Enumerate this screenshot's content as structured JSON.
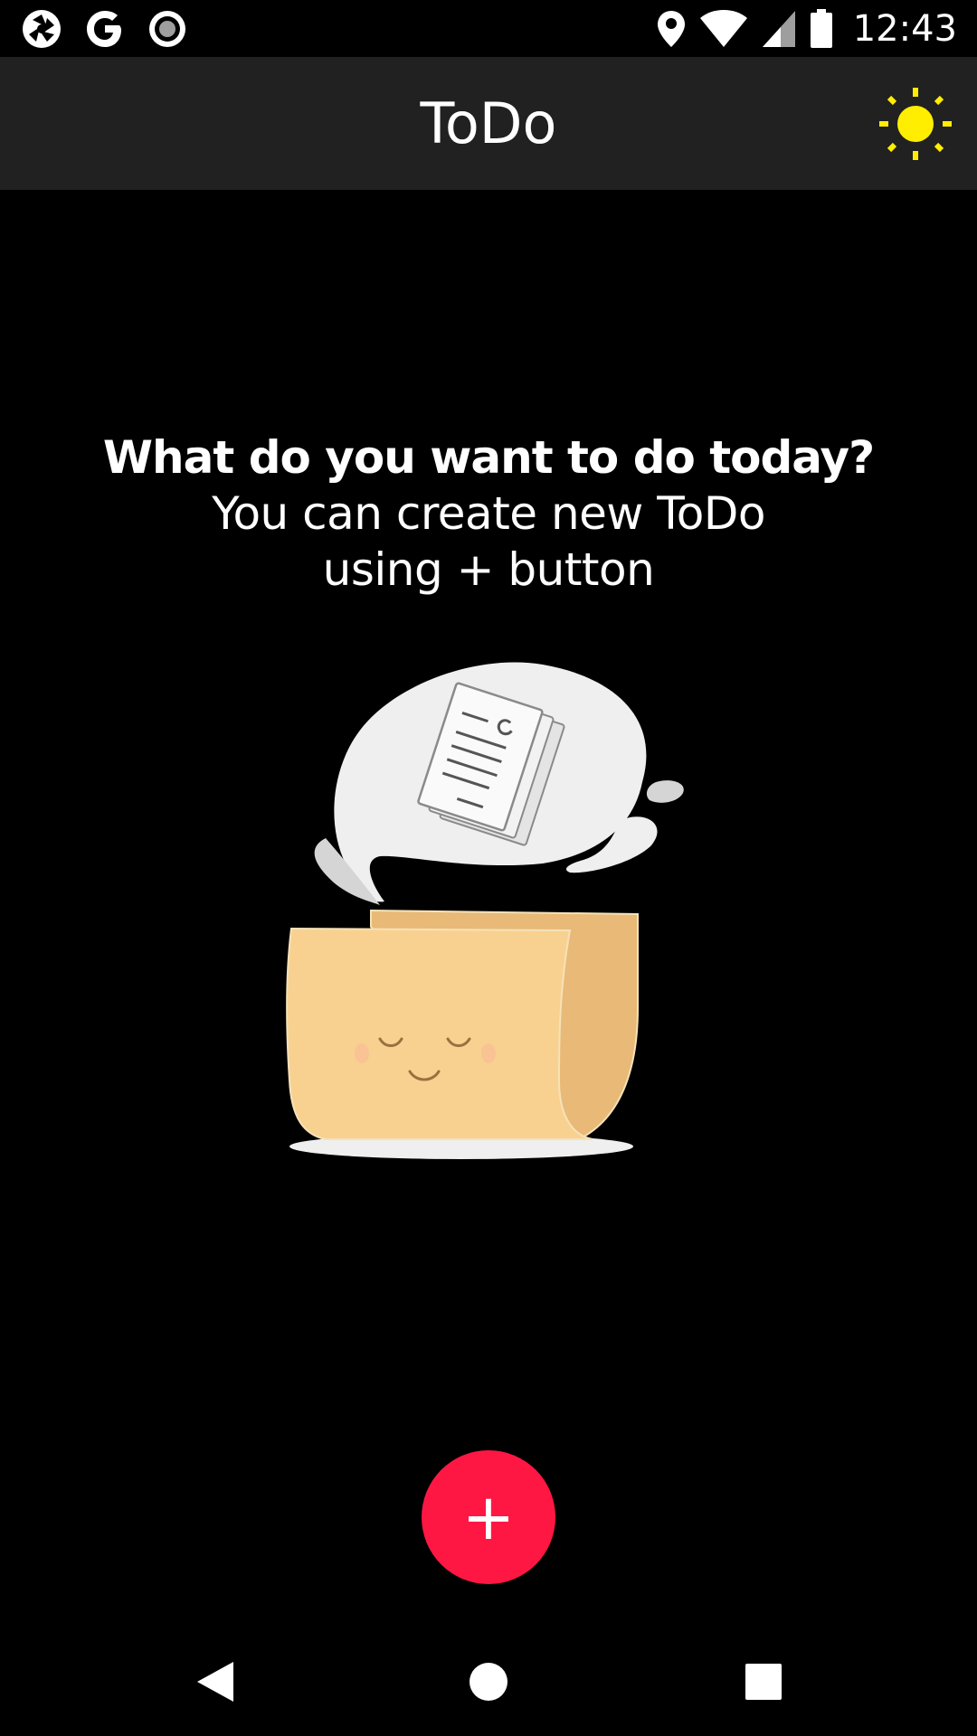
{
  "status_bar": {
    "time": "12:43",
    "left_icons": [
      "aperture-icon",
      "google-icon",
      "record-icon"
    ],
    "right_icons": [
      "location-icon",
      "wifi-icon",
      "signal-icon",
      "battery-icon"
    ]
  },
  "app_bar": {
    "title": "ToDo",
    "theme_toggle_icon": "sun-icon",
    "theme_toggle_color": "#ffee00"
  },
  "empty_state": {
    "heading": "What do you want to do today?",
    "body_line1": "You can create new ToDo",
    "body_line2": "using + button",
    "illustration_icon": "folder-with-notes-illustration"
  },
  "fab": {
    "label": "+",
    "color": "#ff1744"
  },
  "nav_bar": {
    "icons": [
      "back-icon",
      "home-icon",
      "recents-icon"
    ]
  },
  "colors": {
    "background": "#000000",
    "app_bar": "#212121",
    "text": "#ffffff",
    "accent": "#ff1744"
  }
}
